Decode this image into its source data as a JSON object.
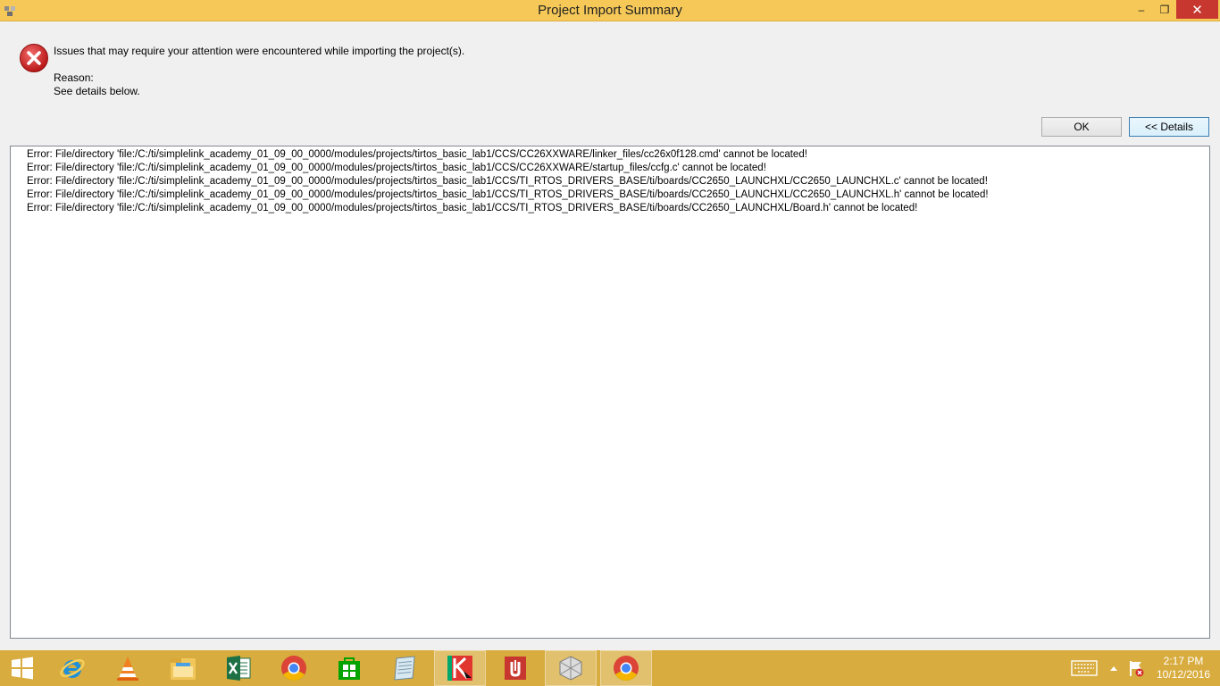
{
  "window": {
    "title": "Project Import Summary",
    "minimize_glyph": "–",
    "restore_glyph": "❐",
    "close_glyph": "✕"
  },
  "message": {
    "icon": "error-icon",
    "summary": "Issues that may require your attention were encountered while importing the project(s).",
    "reason_label": "Reason:",
    "reason_text": "See details below."
  },
  "buttons": {
    "ok_label": "OK",
    "details_label": "<< Details"
  },
  "details": {
    "lines": [
      "Error: File/directory 'file:/C:/ti/simplelink_academy_01_09_00_0000/modules/projects/tirtos_basic_lab1/CCS/CC26XXWARE/linker_files/cc26x0f128.cmd' cannot be located!",
      "Error: File/directory 'file:/C:/ti/simplelink_academy_01_09_00_0000/modules/projects/tirtos_basic_lab1/CCS/CC26XXWARE/startup_files/ccfg.c' cannot be located!",
      "Error: File/directory 'file:/C:/ti/simplelink_academy_01_09_00_0000/modules/projects/tirtos_basic_lab1/CCS/TI_RTOS_DRIVERS_BASE/ti/boards/CC2650_LAUNCHXL/CC2650_LAUNCHXL.c' cannot be located!",
      "Error: File/directory 'file:/C:/ti/simplelink_academy_01_09_00_0000/modules/projects/tirtos_basic_lab1/CCS/TI_RTOS_DRIVERS_BASE/ti/boards/CC2650_LAUNCHXL/CC2650_LAUNCHXL.h' cannot be located!",
      "Error: File/directory 'file:/C:/ti/simplelink_academy_01_09_00_0000/modules/projects/tirtos_basic_lab1/CCS/TI_RTOS_DRIVERS_BASE/ti/boards/CC2650_LAUNCHXL/Board.h' cannot be located!"
    ]
  },
  "taskbar": {
    "items": [
      "start-icon",
      "internet-explorer-icon",
      "vlc-icon",
      "file-explorer-icon",
      "excel-icon",
      "chrome-icon",
      "store-icon",
      "notepad-icon",
      "kaspersky-icon",
      "acrobat-icon",
      "virtual-box-icon",
      "chrome-icon"
    ],
    "clock_time": "2:17 PM",
    "clock_date": "10/12/2016"
  },
  "colors": {
    "title_bar": "#f5c857",
    "taskbar": "#d8ac3e",
    "close_button": "#c7372f",
    "error_red": "#d32b2b"
  }
}
